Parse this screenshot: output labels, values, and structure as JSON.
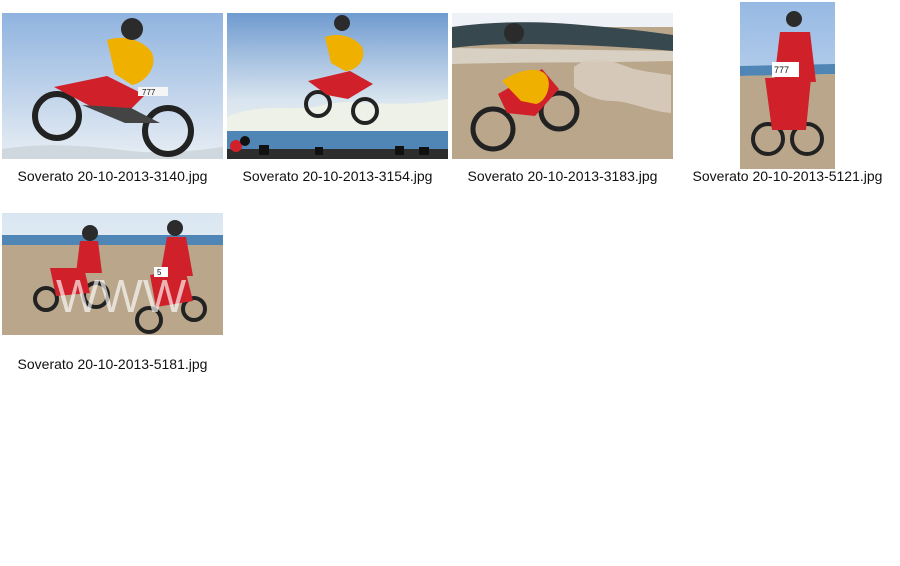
{
  "gallery": {
    "items": [
      {
        "filename": "Soverato 20-10-2013-3140.jpg"
      },
      {
        "filename": "Soverato 20-10-2013-3154.jpg"
      },
      {
        "filename": "Soverato 20-10-2013-3183.jpg"
      },
      {
        "filename": "Soverato 20-10-2013-5121.jpg"
      },
      {
        "filename": "Soverato 20-10-2013-5181.jpg"
      }
    ],
    "watermark_text": "WWW",
    "number_plates": [
      "777",
      "5"
    ]
  },
  "colors": {
    "background": "#ffffff",
    "sky": "#a9c7e6",
    "sand": "#b9a68b",
    "sea": "#4f86b6",
    "bike_red": "#d0202a"
  }
}
